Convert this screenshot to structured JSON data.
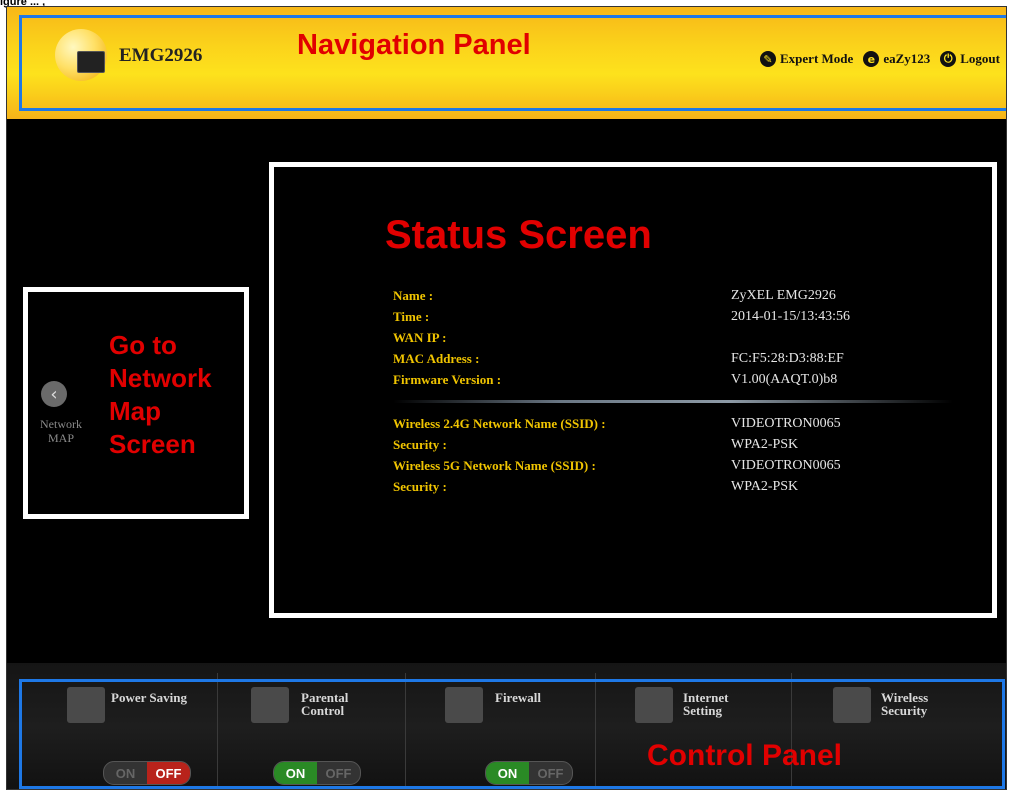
{
  "figure_caption": "igure ... ,",
  "header": {
    "model": "EMG2926",
    "annotation": "Navigation Panel",
    "links": [
      {
        "label": "Expert Mode",
        "icon": "wrench-icon"
      },
      {
        "label": "eaZy123",
        "icon": "easy-icon"
      },
      {
        "label": "Logout",
        "icon": "logout-icon"
      }
    ]
  },
  "left_panel": {
    "nav_label_line1": "Network",
    "nav_label_line2": "MAP",
    "annotation_line1": "Go to",
    "annotation_line2": "Network",
    "annotation_line3": "Map",
    "annotation_line4": "Screen"
  },
  "status": {
    "annotation": "Status Screen",
    "rows": [
      {
        "label": "Name :",
        "value": "ZyXEL EMG2926"
      },
      {
        "label": "Time :",
        "value": "2014-01-15/13:43:56"
      },
      {
        "label": "WAN IP :",
        "value": ""
      },
      {
        "label": "MAC Address :",
        "value": "FC:F5:28:D3:88:EF"
      },
      {
        "label": "Firmware Version :",
        "value": "V1.00(AAQT.0)b8"
      }
    ],
    "wireless_rows": [
      {
        "label": "Wireless 2.4G Network Name (SSID) :",
        "value": "VIDEOTRON0065"
      },
      {
        "label": "Security :",
        "value": "WPA2-PSK"
      },
      {
        "label": "Wireless 5G Network Name (SSID) :",
        "value": "VIDEOTRON0065"
      },
      {
        "label": "Security :",
        "value": "WPA2-PSK"
      }
    ]
  },
  "controls": {
    "annotation": "Control Panel",
    "items": [
      {
        "line1": "Power Saving",
        "line2": "",
        "toggle": "OFF"
      },
      {
        "line1": "Parental",
        "line2": "Control",
        "toggle": "ON"
      },
      {
        "line1": "Firewall",
        "line2": "",
        "toggle": "ON"
      },
      {
        "line1": "Internet",
        "line2": "Setting",
        "toggle": null
      },
      {
        "line1": "Wireless",
        "line2": "Security",
        "toggle": null
      }
    ],
    "on_label": "ON",
    "off_label": "OFF"
  }
}
